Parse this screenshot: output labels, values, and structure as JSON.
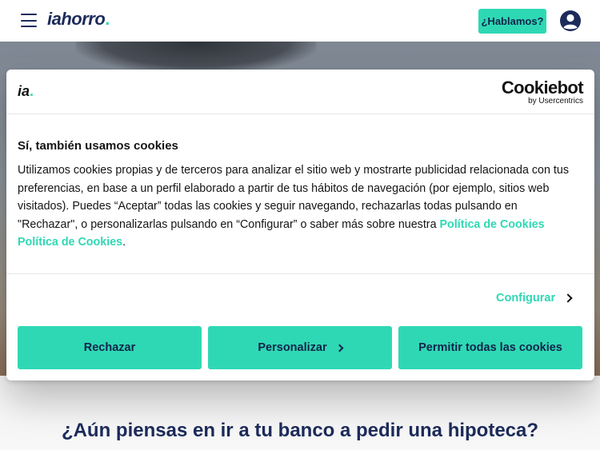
{
  "header": {
    "logo_text": "iahorro",
    "logo_dot": ".",
    "talk_button": "¿Hablamos?",
    "user_icon": "user-circle-icon",
    "menu_icon": "hamburger-menu-icon"
  },
  "page": {
    "section_title": "¿Aún piensas en ir a tu banco a pedir una hipoteca?"
  },
  "cookie_banner": {
    "logo_text": "ia",
    "logo_dot": ".",
    "provider_name": "Cookiebot",
    "provider_sub": "by Usercentrics",
    "title": "Sí, también usamos cookies",
    "body": "Utilizamos cookies propias y de terceros para analizar el sitio web y mostrarte publicidad relacionada con tus preferencias, en base a un perfil elaborado a partir de tus hábitos de navegación (por ejemplo, sitios web visitados). Puedes “Aceptar” todas las cookies y seguir navegando, rechazarlas todas pulsando en \"Rechazar\", o personalizarlas pulsando en “Configurar” o saber más sobre nuestra ",
    "policy_link": "Política de Cookies",
    "policy_link_2": "Política de Cookies",
    "period": ".",
    "configure_label": "Configurar",
    "buttons": {
      "reject": "Rechazar",
      "customize": "Personalizar",
      "allow_all": "Permitir todas las cookies"
    }
  },
  "colors": {
    "accent": "#2fd8b4",
    "navy": "#1c2b5a"
  }
}
